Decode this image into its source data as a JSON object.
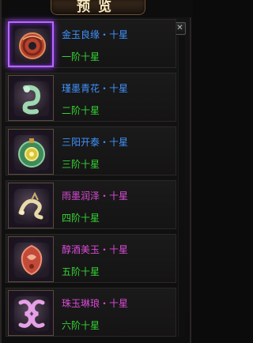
{
  "header": {
    "title": "预览",
    "close_label": "✕"
  },
  "items": [
    {
      "name": "金玉良缘・十星",
      "rank": "一阶十星",
      "name_color": "#3f93ff",
      "icon": "red-jade-coin-icon",
      "selected": true
    },
    {
      "name": "瑾墨青花・十星",
      "rank": "二阶十星",
      "name_color": "#3f93ff",
      "icon": "green-jade-dragon-icon",
      "selected": false
    },
    {
      "name": "三阳开泰・十星",
      "rank": "三阶十星",
      "name_color": "#3f93ff",
      "icon": "green-jade-disk-icon",
      "selected": false
    },
    {
      "name": "雨墨润泽・十星",
      "rank": "四阶十星",
      "name_color": "#d94bd9",
      "icon": "gold-jade-dragon-icon",
      "selected": false
    },
    {
      "name": "醇酒美玉・十星",
      "rank": "五阶十星",
      "name_color": "#d94bd9",
      "icon": "red-jade-carving-icon",
      "selected": false
    },
    {
      "name": "珠玉琳琅・十星",
      "rank": "六阶十星",
      "name_color": "#d94bd9",
      "icon": "pink-jade-dragon-icon",
      "selected": false
    }
  ],
  "colors": {
    "rank_color": "#34d334",
    "selected_border": "#b768ff"
  }
}
